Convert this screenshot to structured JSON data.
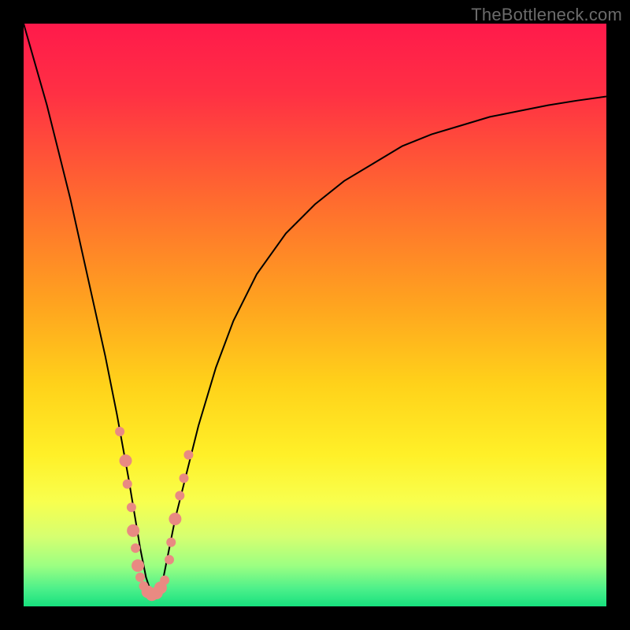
{
  "watermark": "TheBottleneck.com",
  "chart_data": {
    "type": "line",
    "title": "",
    "xlabel": "",
    "ylabel": "",
    "xlim": [
      0,
      100
    ],
    "ylim": [
      0,
      100
    ],
    "grid": false,
    "gradient_stops": [
      {
        "offset": 0.0,
        "color": "#ff1a4b"
      },
      {
        "offset": 0.12,
        "color": "#ff3044"
      },
      {
        "offset": 0.3,
        "color": "#ff6a2f"
      },
      {
        "offset": 0.48,
        "color": "#ffa31f"
      },
      {
        "offset": 0.62,
        "color": "#ffd21a"
      },
      {
        "offset": 0.74,
        "color": "#fff028"
      },
      {
        "offset": 0.82,
        "color": "#f8ff4e"
      },
      {
        "offset": 0.88,
        "color": "#d6ff70"
      },
      {
        "offset": 0.93,
        "color": "#9cff82"
      },
      {
        "offset": 0.97,
        "color": "#4cf08a"
      },
      {
        "offset": 1.0,
        "color": "#17e07e"
      }
    ],
    "curve": {
      "description": "V-shaped bottleneck curve. y=100 is top (max penalty), y=0 is bottom (optimal). Minimum around x≈22.",
      "x": [
        0,
        2,
        4,
        6,
        8,
        10,
        12,
        14,
        16,
        18,
        19,
        20,
        21,
        22,
        23,
        24,
        25,
        26,
        28,
        30,
        33,
        36,
        40,
        45,
        50,
        55,
        60,
        65,
        70,
        75,
        80,
        85,
        90,
        95,
        100
      ],
      "y": [
        100,
        93,
        86,
        78,
        70,
        61,
        52,
        43,
        33,
        22,
        16,
        10,
        5,
        2,
        2,
        5,
        10,
        15,
        23,
        31,
        41,
        49,
        57,
        64,
        69,
        73,
        76,
        79,
        81,
        82.5,
        84,
        85,
        86,
        86.8,
        87.5
      ]
    },
    "markers": {
      "description": "Highlighted sample points near the minimum (salmon dots).",
      "color": "#e98a82",
      "points": [
        {
          "x": 16.5,
          "y": 30,
          "r": 6
        },
        {
          "x": 17.5,
          "y": 25,
          "r": 8
        },
        {
          "x": 17.8,
          "y": 21,
          "r": 6
        },
        {
          "x": 18.5,
          "y": 17,
          "r": 6
        },
        {
          "x": 18.8,
          "y": 13,
          "r": 8
        },
        {
          "x": 19.2,
          "y": 10,
          "r": 6
        },
        {
          "x": 19.6,
          "y": 7,
          "r": 8
        },
        {
          "x": 20.0,
          "y": 5,
          "r": 6
        },
        {
          "x": 20.6,
          "y": 3.5,
          "r": 6
        },
        {
          "x": 21.3,
          "y": 2.5,
          "r": 8
        },
        {
          "x": 22.0,
          "y": 2.0,
          "r": 8
        },
        {
          "x": 22.8,
          "y": 2.3,
          "r": 8
        },
        {
          "x": 23.5,
          "y": 3.2,
          "r": 8
        },
        {
          "x": 24.2,
          "y": 4.5,
          "r": 6
        },
        {
          "x": 25.0,
          "y": 8,
          "r": 6
        },
        {
          "x": 25.3,
          "y": 11,
          "r": 6
        },
        {
          "x": 26.0,
          "y": 15,
          "r": 8
        },
        {
          "x": 26.8,
          "y": 19,
          "r": 6
        },
        {
          "x": 27.5,
          "y": 22,
          "r": 6
        },
        {
          "x": 28.3,
          "y": 26,
          "r": 6
        }
      ]
    }
  }
}
